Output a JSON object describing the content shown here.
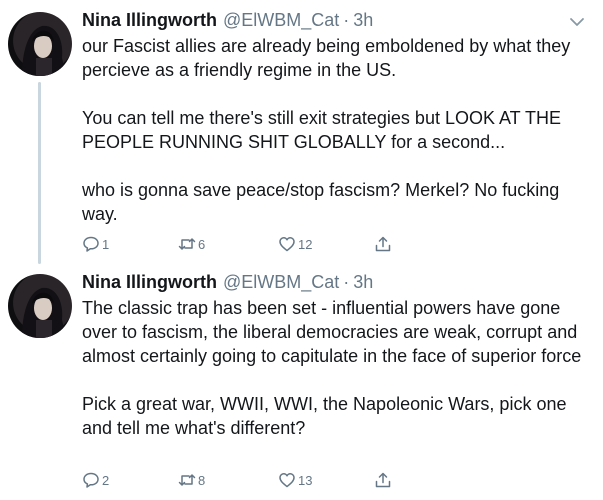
{
  "tweets": [
    {
      "name": "Nina Illingworth",
      "handle": "@ElWBM_Cat",
      "separator": "·",
      "time": "3h",
      "paragraphs": [
        "our Fascist allies are already being emboldened by what they percieve as a friendly regime in the US.",
        "You can tell me there's still exit strategies but LOOK AT THE PEOPLE RUNNING SHIT GLOBALLY for a second...",
        "who is gonna save peace/stop fascism? Merkel? No fucking way."
      ],
      "replies": "1",
      "retweets": "6",
      "likes": "12"
    },
    {
      "name": "Nina Illingworth",
      "handle": "@ElWBM_Cat",
      "separator": "·",
      "time": "3h",
      "paragraphs": [
        "The classic trap has been set - influential powers have gone over to fascism, the liberal democracies are weak, corrupt and almost certainly going to capitulate in the face of superior force",
        "Pick a great war, WWII, WWI, the Napoleonic Wars, pick one and tell me what's different?"
      ],
      "replies": "2",
      "retweets": "8",
      "likes": "13"
    }
  ],
  "icons": {
    "reply": "reply-icon",
    "retweet": "retweet-icon",
    "like": "heart-icon",
    "share": "share-icon",
    "caret": "chevron-down-icon"
  },
  "colors": {
    "text": "#14171a",
    "secondary": "#657786",
    "thread_line": "#c9d6df"
  }
}
